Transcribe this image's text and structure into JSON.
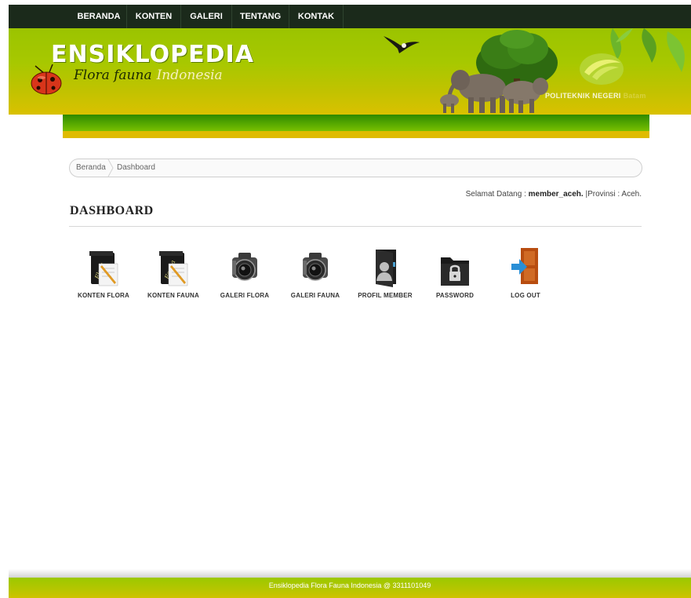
{
  "nav": {
    "items": [
      {
        "label": "BERANDA"
      },
      {
        "label": "KONTEN"
      },
      {
        "label": "GALERI"
      },
      {
        "label": "TENTANG"
      },
      {
        "label": "KONTAK"
      }
    ]
  },
  "banner": {
    "title": "ENSIKLOPEDIA",
    "subtitle_main": "Flora fauna",
    "subtitle_accent": "Indonesia",
    "institution": "POLITEKNIK NEGERI",
    "institution_faded": "Batam"
  },
  "breadcrumb": {
    "items": [
      {
        "label": "Beranda"
      },
      {
        "label": "Dashboard"
      }
    ]
  },
  "welcome": {
    "prefix": "Selamat Datang :",
    "username": "member_aceh.",
    "province": "|Provinsi : Aceh."
  },
  "page": {
    "title": "DASHBOARD"
  },
  "dashboard": {
    "items": [
      {
        "label": "KONTEN FLORA",
        "icon": "flora-notebook-icon"
      },
      {
        "label": "KONTEN FAUNA",
        "icon": "fauna-notebook-icon"
      },
      {
        "label": "GALERI FLORA",
        "icon": "camera-icon"
      },
      {
        "label": "GALERI FAUNA",
        "icon": "camera-icon"
      },
      {
        "label": "PROFIL MEMBER",
        "icon": "profile-folder-icon"
      },
      {
        "label": "PASSWORD",
        "icon": "lock-folder-icon"
      },
      {
        "label": "LOG OUT",
        "icon": "logout-door-icon"
      }
    ]
  },
  "footer": {
    "text": "Ensiklopedia Flora Fauna Indonesia @ 3311101049"
  },
  "colors": {
    "nav_bg": "#1b2a1b",
    "banner_green": "#9bc400",
    "banner_gold": "#dab800",
    "footer": "#a6c800"
  }
}
